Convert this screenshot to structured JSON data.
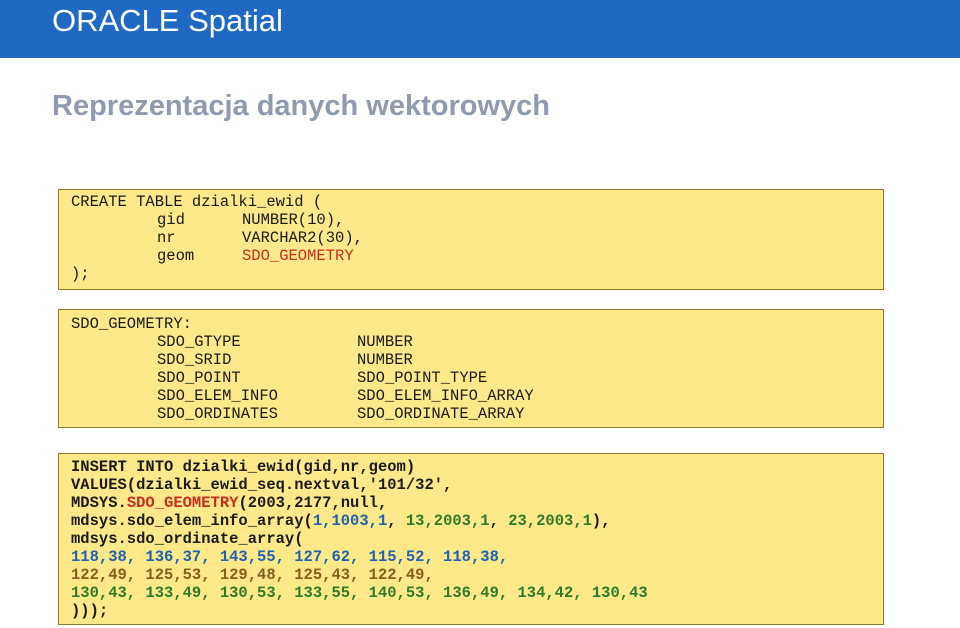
{
  "header": {
    "title": "ORACLE Spatial"
  },
  "subtitle": "Reprezentacja danych wektorowych",
  "colors": {
    "header_bg": "#1f69c4",
    "code_bg": "#fde88a",
    "red": "#c62d20",
    "blue": "#1e62b0",
    "green": "#2f7a2a",
    "brown": "#8a5a1e"
  },
  "create_block": {
    "l1": "CREATE TABLE dzialki_ewid (",
    "c1": "gid",
    "t1": "NUMBER(10),",
    "c2": "nr",
    "t2": "VARCHAR2(30),",
    "c3": "geom",
    "t3": "SDO_GEOMETRY",
    "end": ");"
  },
  "geometry_block": {
    "header": "SDO_GEOMETRY:",
    "rows": [
      {
        "name": "SDO_GTYPE",
        "type": "NUMBER"
      },
      {
        "name": "SDO_SRID",
        "type": "NUMBER"
      },
      {
        "name": "SDO_POINT",
        "type": "SDO_POINT_TYPE"
      },
      {
        "name": "SDO_ELEM_INFO",
        "type": "SDO_ELEM_INFO_ARRAY"
      },
      {
        "name": "SDO_ORDINATES",
        "type": "SDO_ORDINATE_ARRAY"
      }
    ]
  },
  "insert_block": {
    "l1": "INSERT INTO dzialki_ewid(gid,nr,geom)",
    "l2": "VALUES(dzialki_ewid_seq.nextval,'101/32',",
    "l3a": "MDSYS.",
    "l3b": "SDO_GEOMETRY",
    "l3c": "(2003,2177,null,",
    "l4a": "mdsys.sdo_elem_info_array(",
    "l4b": "1,1003,1",
    "l4c": ", ",
    "l4d": "13,2003,1",
    "l4e": ", ",
    "l4f": "23,2003,1",
    "l4g": "),",
    "l5": "mdsys.sdo_ordinate_array(",
    "l6": "118,38, 136,37, 143,55, 127,62, 115,52, 118,38,",
    "l7": "122,49, 125,53, 129,48, 125,43, 122,49,",
    "l8": "130,43, 133,49, 130,53, 133,55, 140,53, 136,49, 134,42, 130,43",
    "l9": ")));"
  }
}
